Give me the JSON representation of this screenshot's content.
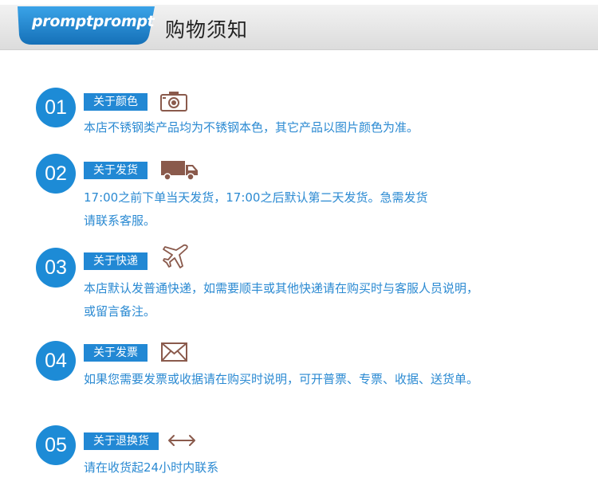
{
  "header": {
    "badge": "promptprompt",
    "title": "购物须知"
  },
  "colors": {
    "accent": "#1d8bd6",
    "text": "#2b8ad2",
    "icon": "#8a5a4c"
  },
  "sections": [
    {
      "num": "01",
      "tag": "关于颜色",
      "icon": "camera-icon",
      "lines": [
        "本店不锈钢类产品均为不锈钢本色，其它产品以图片颜色为准。"
      ]
    },
    {
      "num": "02",
      "tag": "关于发货",
      "icon": "truck-icon",
      "lines": [
        "17:00之前下单当天发货，17:00之后默认第二天发货。急需发货",
        "请联系客服。"
      ]
    },
    {
      "num": "03",
      "tag": "关于快递",
      "icon": "airplane-icon",
      "lines": [
        "本店默认发普通快递，如需要顺丰或其他快递请在购买时与客服人员说明，",
        "或留言备注。"
      ]
    },
    {
      "num": "04",
      "tag": "关于发票",
      "icon": "envelope-icon",
      "lines": [
        "如果您需要发票或收据请在购买时说明，可开普票、专票、收据、送货单。"
      ]
    },
    {
      "num": "05",
      "tag": "关于退换货",
      "icon": "double-arrow-icon",
      "lines": [
        "请在收货起24小时内联系"
      ]
    }
  ]
}
